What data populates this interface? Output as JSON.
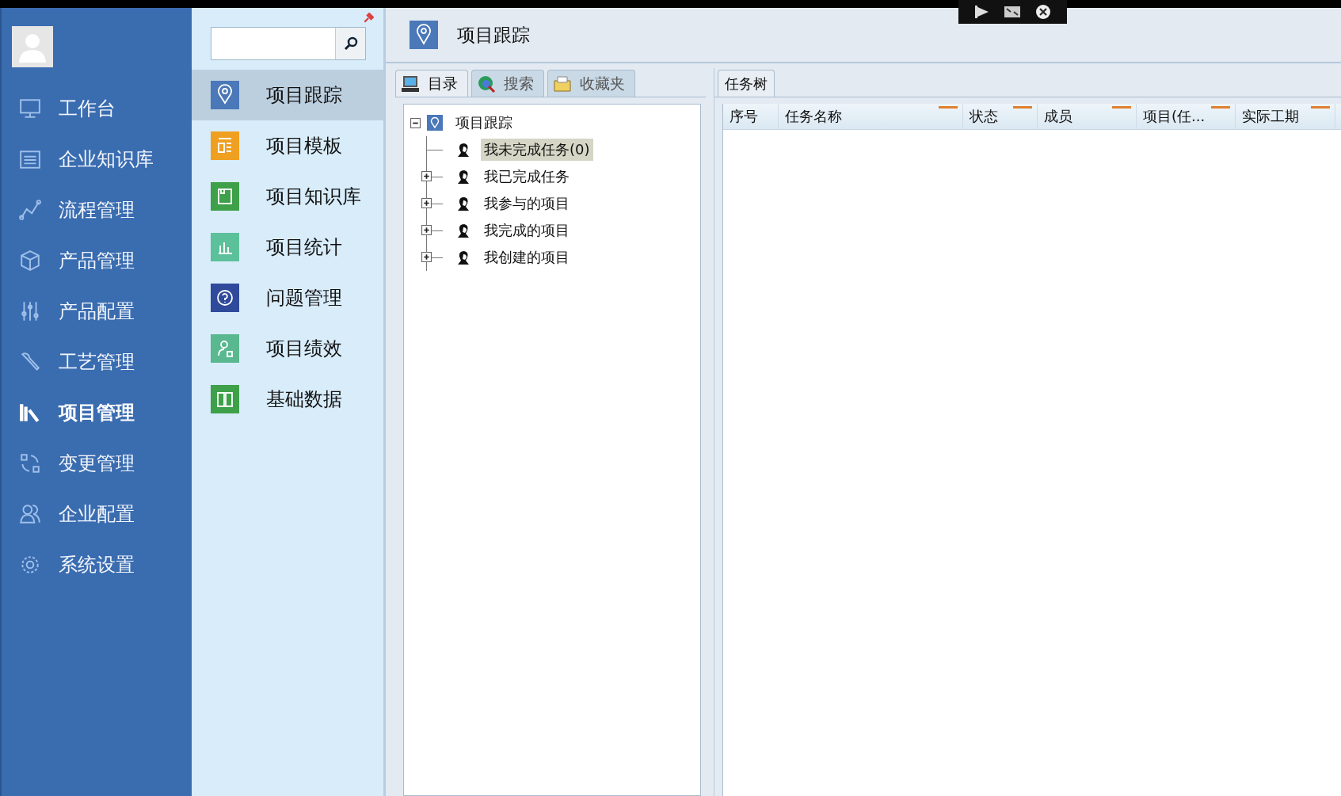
{
  "sidebar": {
    "items": [
      {
        "label": "工作台",
        "selected": false
      },
      {
        "label": "企业知识库",
        "selected": false
      },
      {
        "label": "流程管理",
        "selected": false
      },
      {
        "label": "产品管理",
        "selected": false
      },
      {
        "label": "产品配置",
        "selected": false
      },
      {
        "label": "工艺管理",
        "selected": false
      },
      {
        "label": "项目管理",
        "selected": true
      },
      {
        "label": "变更管理",
        "selected": false
      },
      {
        "label": "企业配置",
        "selected": false
      },
      {
        "label": "系统设置",
        "selected": false
      }
    ]
  },
  "module_menu": {
    "items": [
      {
        "label": "项目跟踪",
        "selected": true,
        "color": "#4a78b8"
      },
      {
        "label": "项目模板",
        "selected": false,
        "color": "#f0a020"
      },
      {
        "label": "项目知识库",
        "selected": false,
        "color": "#3fa04a"
      },
      {
        "label": "项目统计",
        "selected": false,
        "color": "#5cc09a"
      },
      {
        "label": "问题管理",
        "selected": false,
        "color": "#2f4a9a"
      },
      {
        "label": "项目绩效",
        "selected": false,
        "color": "#5ab890"
      },
      {
        "label": "基础数据",
        "selected": false,
        "color": "#3fa04a"
      }
    ]
  },
  "page": {
    "title": "项目跟踪"
  },
  "left_tabs": [
    {
      "label": "目录",
      "selected": true
    },
    {
      "label": "搜索",
      "selected": false
    },
    {
      "label": "收藏夹",
      "selected": false
    }
  ],
  "tree": {
    "label": "项目跟踪",
    "expanded": true,
    "children": [
      {
        "label": "我未完成任务(0)",
        "kind": "leaf",
        "selected": true
      },
      {
        "label": "我已完成任务",
        "kind": "group",
        "expanded": false,
        "selected": false
      },
      {
        "label": "我参与的项目",
        "kind": "group",
        "expanded": false,
        "selected": false
      },
      {
        "label": "我完成的项目",
        "kind": "group",
        "expanded": false,
        "selected": false
      },
      {
        "label": "我创建的项目",
        "kind": "group",
        "expanded": false,
        "selected": false
      }
    ]
  },
  "right_tabs": [
    {
      "label": "任务树",
      "selected": true
    }
  ],
  "table": {
    "columns": [
      "序号",
      "任务名称",
      "状态",
      "成员",
      "项目(任...",
      "实际工期"
    ]
  }
}
